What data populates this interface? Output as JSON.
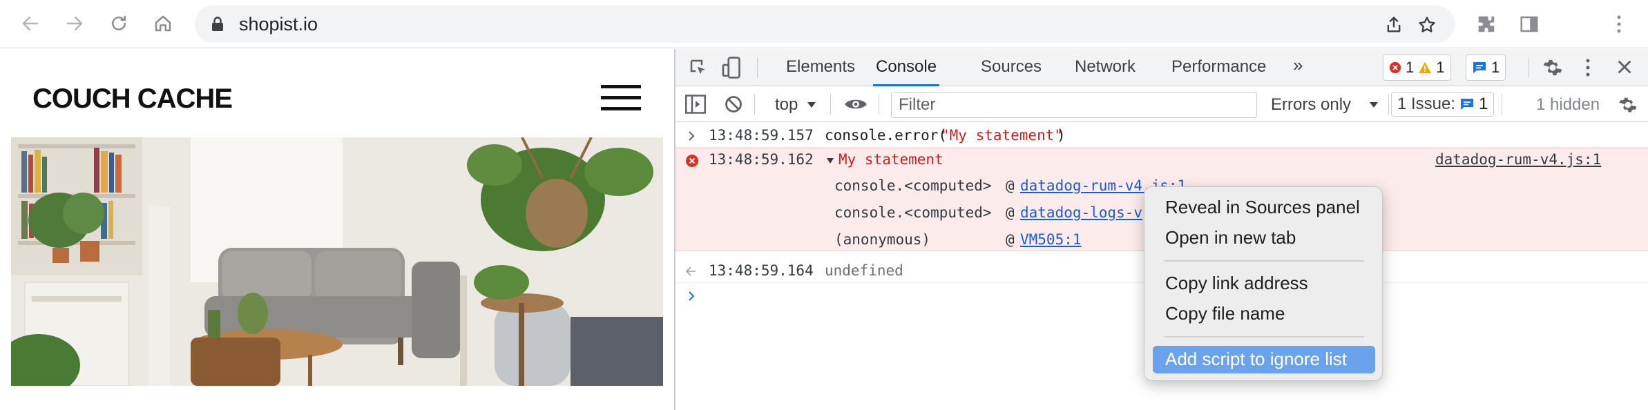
{
  "browser": {
    "url": "shopist.io",
    "back_icon": "arrow-left-icon",
    "forward_icon": "arrow-right-icon",
    "reload_icon": "reload-icon",
    "home_icon": "home-icon"
  },
  "page": {
    "brand": "COUCH CACHE",
    "hero_image": "living-room-photo"
  },
  "devtools": {
    "tabs": [
      "Elements",
      "Console",
      "Sources",
      "Network",
      "Performance"
    ],
    "active_tab": "Console",
    "more_tabs": "»",
    "error_count": "1",
    "warning_count": "1",
    "message_count": "1",
    "toolbar": {
      "context": "top",
      "filter_placeholder": "Filter",
      "levels": "Errors only",
      "issues_label": "1 Issue:",
      "issues_count": "1",
      "hidden": "1 hidden"
    },
    "console": {
      "input1": {
        "time": "13:48:59.157",
        "code_prefix": "console.error(",
        "code_string": "\"My statement\"",
        "code_suffix": ")"
      },
      "error": {
        "time": "13:48:59.162",
        "message": "My statement",
        "source": "datadog-rum-v4.js:1",
        "stack": [
          {
            "fn": "console.<computed>",
            "at": "@",
            "link": "datadog-rum-v4.js:1"
          },
          {
            "fn": "console.<computed>",
            "at": "@",
            "link": "datadog-logs-v"
          },
          {
            "fn": "(anonymous)",
            "at": "@",
            "link": "VM505:1"
          }
        ]
      },
      "result": {
        "time": "13:48:59.164",
        "value": "undefined"
      }
    }
  },
  "context_menu": {
    "items": [
      "Reveal in Sources panel",
      "Open in new tab",
      "Copy link address",
      "Copy file name",
      "Add script to ignore list"
    ],
    "highlighted": "Add script to ignore list"
  }
}
